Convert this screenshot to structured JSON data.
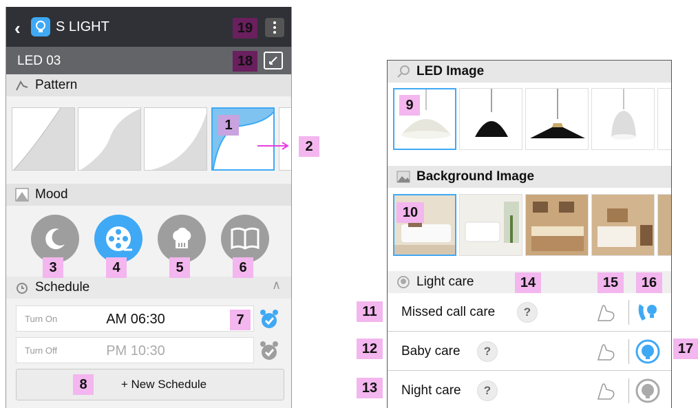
{
  "app": {
    "title": "S LIGHT",
    "device": "LED 03"
  },
  "sections": {
    "pattern": "Pattern",
    "mood": "Mood",
    "schedule": "Schedule"
  },
  "schedule": {
    "rows": [
      {
        "label": "Turn On",
        "time": "AM 06:30"
      },
      {
        "label": "Turn Off",
        "time": "PM 10:30"
      }
    ],
    "new_button": "+ New Schedule"
  },
  "panel": {
    "led_image": "LED Image",
    "background_image": "Background Image",
    "light_care": "Light care",
    "care_items": [
      "Missed call care",
      "Baby care",
      "Night care"
    ],
    "help": "?"
  },
  "callouts": [
    "1",
    "2",
    "3",
    "4",
    "5",
    "6",
    "7",
    "8",
    "9",
    "10",
    "11",
    "12",
    "13",
    "14",
    "15",
    "16",
    "17",
    "18",
    "19"
  ],
  "colors": {
    "accent": "#3fa9f5",
    "appbar": "#2f3136",
    "devbar": "#626468",
    "badge": "#f3b6ee",
    "badge_dark": "#6a1f5e",
    "arrow": "#e83ee0"
  }
}
